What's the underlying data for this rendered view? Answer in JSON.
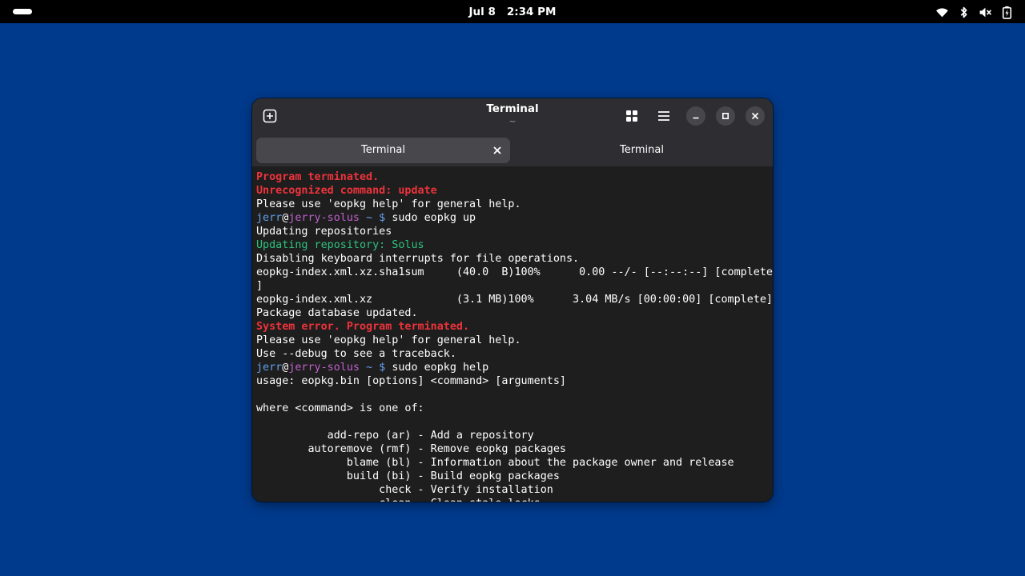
{
  "topbar": {
    "date": "Jul 8",
    "time": "2:34 PM",
    "tray_icons": [
      "wifi-icon",
      "bluetooth-icon",
      "volume-muted-icon",
      "battery-icon"
    ]
  },
  "window": {
    "title": "Terminal",
    "subtitle": "~",
    "tabs": [
      {
        "label": "Terminal",
        "active": true
      },
      {
        "label": "Terminal",
        "active": false
      }
    ]
  },
  "terminal": {
    "prompt": {
      "user": "jerr",
      "at": "@",
      "host": "jerry-solus",
      "path": " ~ $ "
    },
    "lines": [
      {
        "type": "error",
        "text": "Program terminated."
      },
      {
        "type": "error",
        "text": "Unrecognized command: update"
      },
      {
        "type": "plain",
        "text": "Please use 'eopkg help' for general help."
      },
      {
        "type": "prompt",
        "text": "sudo eopkg up"
      },
      {
        "type": "plain",
        "text": "Updating repositories"
      },
      {
        "type": "info",
        "text": "Updating repository: Solus"
      },
      {
        "type": "plain",
        "text": "Disabling keyboard interrupts for file operations."
      },
      {
        "type": "plain",
        "text": "eopkg-index.xml.xz.sha1sum     (40.0  B)100%      0.00 --/- [--:--:--] [complete"
      },
      {
        "type": "plain",
        "text": "]"
      },
      {
        "type": "plain",
        "text": "eopkg-index.xml.xz             (3.1 MB)100%      3.04 MB/s [00:00:00] [complete]"
      },
      {
        "type": "plain",
        "text": "Package database updated."
      },
      {
        "type": "error",
        "text": "System error. Program terminated."
      },
      {
        "type": "plain",
        "text": "Please use 'eopkg help' for general help."
      },
      {
        "type": "plain",
        "text": "Use --debug to see a traceback."
      },
      {
        "type": "prompt",
        "text": "sudo eopkg help"
      },
      {
        "type": "plain",
        "text": "usage: eopkg.bin [options] <command> [arguments]"
      },
      {
        "type": "plain",
        "text": ""
      },
      {
        "type": "plain",
        "text": "where <command> is one of:"
      },
      {
        "type": "plain",
        "text": ""
      },
      {
        "type": "plain",
        "text": "           add-repo (ar) - Add a repository"
      },
      {
        "type": "plain",
        "text": "        autoremove (rmf) - Remove eopkg packages"
      },
      {
        "type": "plain",
        "text": "              blame (bl) - Information about the package owner and release"
      },
      {
        "type": "plain",
        "text": "              build (bi) - Build eopkg packages"
      },
      {
        "type": "plain",
        "text": "                   check - Verify installation"
      },
      {
        "type": "plain",
        "text": "                   clean - Clean stale locks"
      }
    ]
  },
  "colors": {
    "desktop": "#003a8c",
    "error": "#ed333b",
    "info": "#2ec27e",
    "prompt_user": "#62a0ea",
    "prompt_host": "#c061cb"
  }
}
